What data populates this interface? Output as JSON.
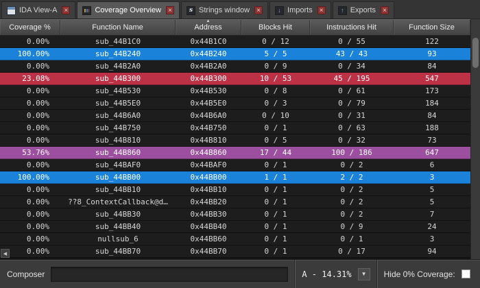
{
  "icons": {
    "close": "×",
    "dropdown": "▼",
    "sort_asc": "▲",
    "hscroll_left": "◀"
  },
  "colors": {
    "row_default": "#1d1d1d",
    "row_blue": "#1a82d8",
    "row_red": "#bd3147",
    "row_purple": "#9c4f9e"
  },
  "tabs": [
    {
      "id": "ida-view-a",
      "label": "IDA View-A",
      "active": false
    },
    {
      "id": "coverage-overview",
      "label": "Coverage Overview",
      "active": true
    },
    {
      "id": "strings-window",
      "label": "Strings window",
      "active": false
    },
    {
      "id": "imports",
      "label": "Imports",
      "active": false
    },
    {
      "id": "exports",
      "label": "Exports",
      "active": false
    }
  ],
  "table": {
    "columns": [
      {
        "label": "Coverage %",
        "sorted": false
      },
      {
        "label": "Function Name",
        "sorted": false
      },
      {
        "label": "Address",
        "sorted": true
      },
      {
        "label": "Blocks Hit",
        "sorted": false
      },
      {
        "label": "Instructions Hit",
        "sorted": false
      },
      {
        "label": "Function Size",
        "sorted": false
      }
    ],
    "rows": [
      {
        "cells": [
          "0.00%",
          "sub_44B1C0",
          "0x44B1C0",
          "0 / 12",
          "0 / 55",
          "122"
        ],
        "hl": ""
      },
      {
        "cells": [
          "100.00%",
          "sub_44B240",
          "0x44B240",
          "5 / 5",
          "43 / 43",
          "93"
        ],
        "hl": "blue"
      },
      {
        "cells": [
          "0.00%",
          "sub_44B2A0",
          "0x44B2A0",
          "0 / 9",
          "0 / 34",
          "84"
        ],
        "hl": ""
      },
      {
        "cells": [
          "23.08%",
          "sub_44B300",
          "0x44B300",
          "10 / 53",
          "45 / 195",
          "547"
        ],
        "hl": "red"
      },
      {
        "cells": [
          "0.00%",
          "sub_44B530",
          "0x44B530",
          "0 / 8",
          "0 / 61",
          "173"
        ],
        "hl": ""
      },
      {
        "cells": [
          "0.00%",
          "sub_44B5E0",
          "0x44B5E0",
          "0 / 3",
          "0 / 79",
          "184"
        ],
        "hl": ""
      },
      {
        "cells": [
          "0.00%",
          "sub_44B6A0",
          "0x44B6A0",
          "0 / 10",
          "0 / 31",
          "84"
        ],
        "hl": ""
      },
      {
        "cells": [
          "0.00%",
          "sub_44B750",
          "0x44B750",
          "0 / 1",
          "0 / 63",
          "188"
        ],
        "hl": ""
      },
      {
        "cells": [
          "0.00%",
          "sub_44B810",
          "0x44B810",
          "0 / 5",
          "0 / 32",
          "73"
        ],
        "hl": ""
      },
      {
        "cells": [
          "53.76%",
          "sub_44B860",
          "0x44B860",
          "17 / 44",
          "100 / 186",
          "647"
        ],
        "hl": "purple"
      },
      {
        "cells": [
          "0.00%",
          "sub_44BAF0",
          "0x44BAF0",
          "0 / 1",
          "0 / 2",
          "6"
        ],
        "hl": ""
      },
      {
        "cells": [
          "100.00%",
          "sub_44BB00",
          "0x44BB00",
          "1 / 1",
          "2 / 2",
          "3"
        ],
        "hl": "blue"
      },
      {
        "cells": [
          "0.00%",
          "sub_44BB10",
          "0x44BB10",
          "0 / 1",
          "0 / 2",
          "5"
        ],
        "hl": ""
      },
      {
        "cells": [
          "0.00%",
          "??8_ContextCallback@d…",
          "0x44BB20",
          "0 / 1",
          "0 / 2",
          "5"
        ],
        "hl": ""
      },
      {
        "cells": [
          "0.00%",
          "sub_44BB30",
          "0x44BB30",
          "0 / 1",
          "0 / 2",
          "7"
        ],
        "hl": ""
      },
      {
        "cells": [
          "0.00%",
          "sub_44BB40",
          "0x44BB40",
          "0 / 1",
          "0 / 9",
          "24"
        ],
        "hl": ""
      },
      {
        "cells": [
          "0.00%",
          "nullsub_6",
          "0x44BB60",
          "0 / 1",
          "0 / 1",
          "3"
        ],
        "hl": ""
      },
      {
        "cells": [
          "0.00%",
          "sub_44BB70",
          "0x44BB70",
          "0 / 1",
          "0 / 17",
          "94"
        ],
        "hl": ""
      }
    ]
  },
  "footer": {
    "composer_label": "Composer",
    "composer_value": "",
    "composer_placeholder": "",
    "coverage_selector": "A - 14.31%",
    "hide_zero_label": "Hide 0% Coverage:",
    "hide_zero_checked": false
  }
}
